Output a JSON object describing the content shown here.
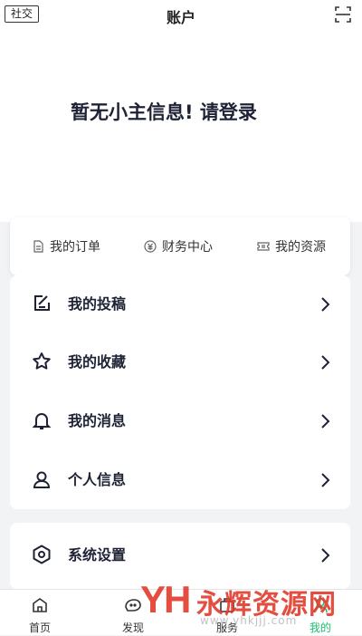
{
  "header": {
    "social_label": "社交",
    "title": "账户",
    "login_prompt": "暂无小主信息! 请登录"
  },
  "quick_actions": [
    {
      "label": "我的订单",
      "icon": "document-icon"
    },
    {
      "label": "财务中心",
      "icon": "coin-icon"
    },
    {
      "label": "我的资源",
      "icon": "ticket-icon"
    }
  ],
  "menu_main": [
    {
      "label": "我的投稿",
      "icon": "edit-icon"
    },
    {
      "label": "我的收藏",
      "icon": "star-icon"
    },
    {
      "label": "我的消息",
      "icon": "bell-icon"
    },
    {
      "label": "个人信息",
      "icon": "user-icon"
    }
  ],
  "menu_settings": [
    {
      "label": "系统设置",
      "icon": "settings-icon"
    }
  ],
  "tabbar": [
    {
      "label": "首页",
      "icon": "home-icon"
    },
    {
      "label": "发现",
      "icon": "discover-icon"
    },
    {
      "label": "服务",
      "icon": "service-icon"
    },
    {
      "label": "我的",
      "icon": "profile-icon",
      "active": true
    }
  ],
  "watermark": {
    "logo": "YH",
    "text": "永辉资源网",
    "url": "www.yhkjjj.com"
  },
  "colors": {
    "accent": "#17c06d",
    "text_dark": "#1e2235",
    "background": "#f2f3f5",
    "watermark": "#e23b2d"
  }
}
